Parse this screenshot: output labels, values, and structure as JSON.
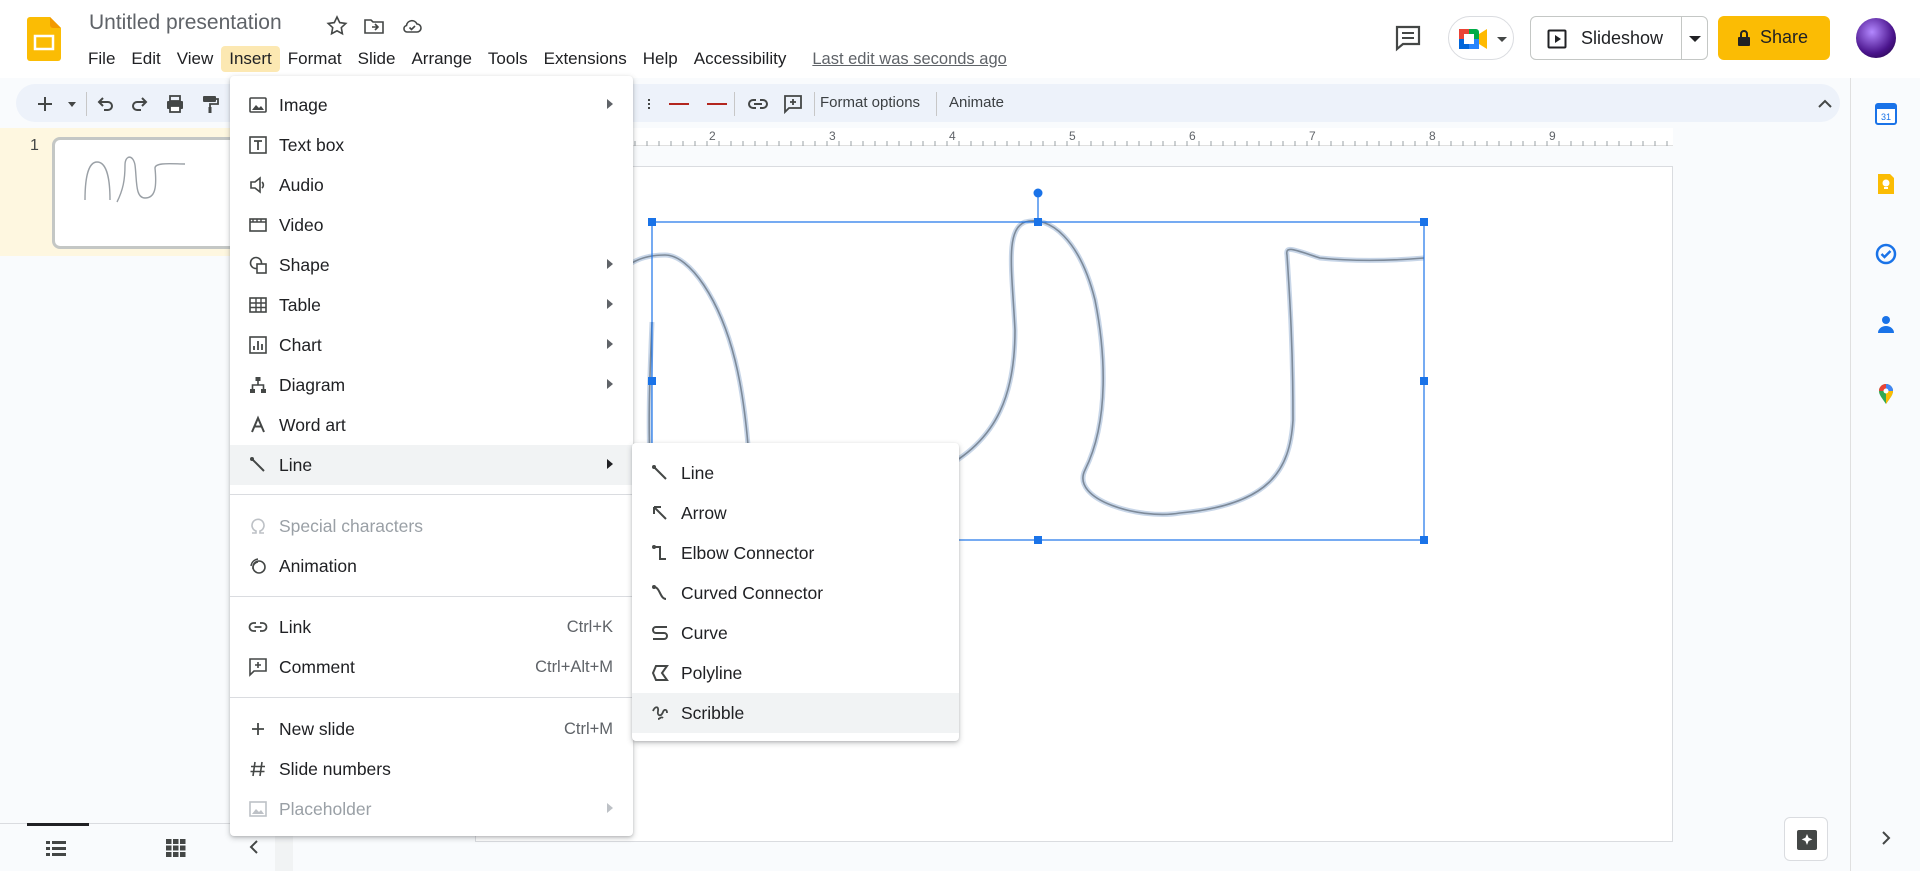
{
  "app": {
    "title": "Untitled presentation",
    "last_edit": "Last edit was seconds ago"
  },
  "menubar": [
    "File",
    "Edit",
    "View",
    "Insert",
    "Format",
    "Slide",
    "Arrange",
    "Tools",
    "Extensions",
    "Help",
    "Accessibility"
  ],
  "menubar_active": "Insert",
  "header": {
    "slideshow_label": "Slideshow",
    "share_label": "Share"
  },
  "toolbar": {
    "format_options": "Format options",
    "animate": "Animate"
  },
  "ruler": {
    "ticks": [
      "2",
      "3",
      "4",
      "5",
      "6",
      "7",
      "8",
      "9"
    ]
  },
  "filmstrip": {
    "slide_number": "1"
  },
  "insert_menu": {
    "items": [
      {
        "label": "Image",
        "icon": "image-icon",
        "submenu": true
      },
      {
        "label": "Text box",
        "icon": "text-box-icon"
      },
      {
        "label": "Audio",
        "icon": "audio-icon"
      },
      {
        "label": "Video",
        "icon": "video-icon"
      },
      {
        "label": "Shape",
        "icon": "shape-icon",
        "submenu": true
      },
      {
        "label": "Table",
        "icon": "table-icon",
        "submenu": true
      },
      {
        "label": "Chart",
        "icon": "chart-icon",
        "submenu": true
      },
      {
        "label": "Diagram",
        "icon": "diagram-icon",
        "submenu": true
      },
      {
        "label": "Word art",
        "icon": "word-art-icon"
      },
      {
        "label": "Line",
        "icon": "line-icon",
        "submenu": true,
        "highlighted": true
      },
      {
        "label": "Special characters",
        "icon": "omega-icon",
        "disabled": true
      },
      {
        "label": "Animation",
        "icon": "animation-icon"
      },
      {
        "label": "Link",
        "icon": "link-icon",
        "shortcut": "Ctrl+K"
      },
      {
        "label": "Comment",
        "icon": "comment-icon",
        "shortcut": "Ctrl+Alt+M"
      },
      {
        "label": "New slide",
        "icon": "plus-icon",
        "shortcut": "Ctrl+M"
      },
      {
        "label": "Slide numbers",
        "icon": "hash-icon"
      },
      {
        "label": "Placeholder",
        "icon": "placeholder-icon",
        "submenu": true,
        "disabled": true
      }
    ]
  },
  "line_submenu": {
    "items": [
      {
        "label": "Line",
        "icon": "line-icon"
      },
      {
        "label": "Arrow",
        "icon": "arrow-icon"
      },
      {
        "label": "Elbow Connector",
        "icon": "elbow-connector-icon"
      },
      {
        "label": "Curved Connector",
        "icon": "curved-connector-icon"
      },
      {
        "label": "Curve",
        "icon": "curve-icon"
      },
      {
        "label": "Polyline",
        "icon": "polyline-icon"
      },
      {
        "label": "Scribble",
        "icon": "scribble-icon",
        "highlighted": true
      }
    ]
  },
  "colors": {
    "accent": "#1a73e8",
    "share": "#fbbc04",
    "menu_active": "#fce8b2",
    "selection": "#1a73e8",
    "scribble_stroke": "#7d8a99"
  }
}
